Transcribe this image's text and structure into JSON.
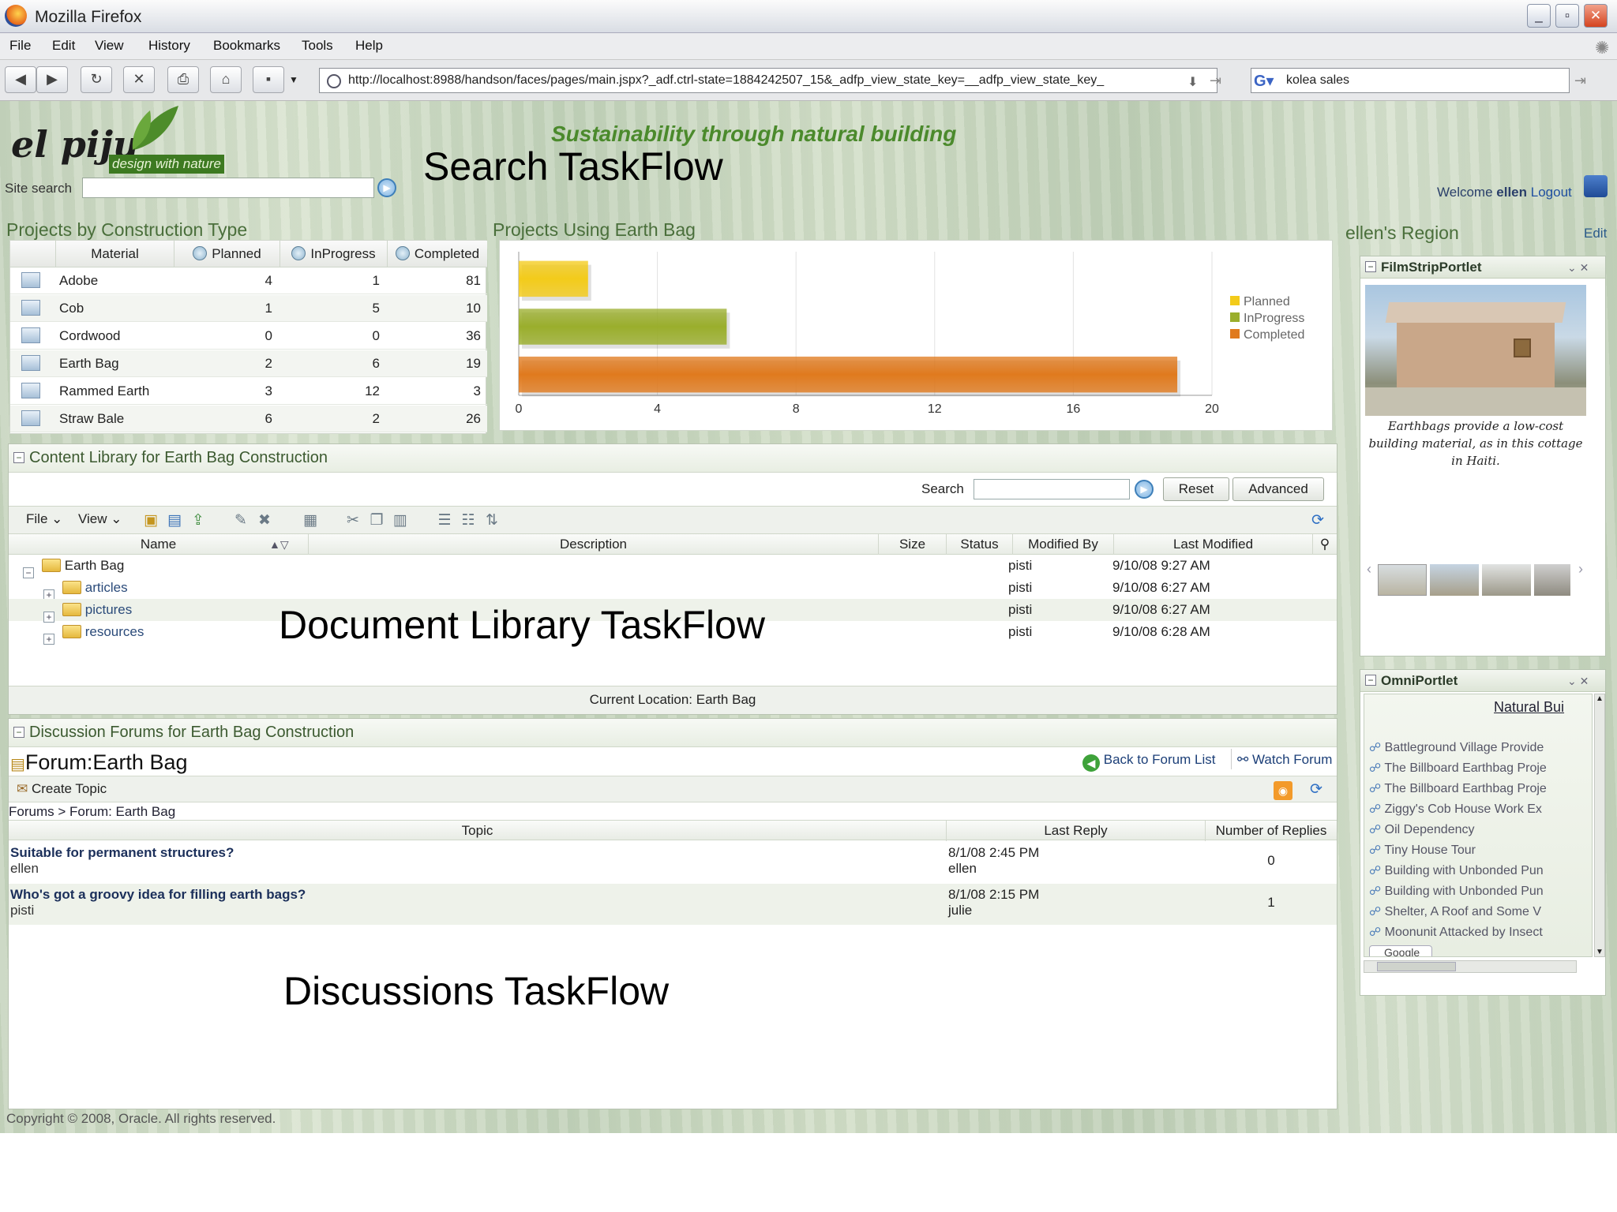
{
  "window": {
    "title": "Mozilla Firefox",
    "minimize": "_",
    "maximize": "▫",
    "close": "✕"
  },
  "menu": [
    "File",
    "Edit",
    "View",
    "History",
    "Bookmarks",
    "Tools",
    "Help"
  ],
  "nav": {
    "url": "http://localhost:8988/handson/faces/pages/main.jspx?_adf.ctrl-state=1884242507_15&_adfp_view_state_key=__adfp_view_state_key_",
    "search_value": "kolea sales"
  },
  "header": {
    "logo_main": "el piju",
    "logo_sub": "design with nature",
    "tagline": "Sustainability through natural building",
    "search_taskflow_caption": "Search TaskFlow",
    "site_search_label": "Site search",
    "welcome": "Welcome",
    "user": "ellen",
    "logout": "Logout"
  },
  "projects_table": {
    "title": "Projects by Construction Type",
    "headers": {
      "material": "Material",
      "planned": "Planned",
      "inprogress": "InProgress",
      "completed": "Completed"
    },
    "rows": [
      {
        "material": "Adobe",
        "planned": "4",
        "inprogress": "1",
        "completed": "81"
      },
      {
        "material": "Cob",
        "planned": "1",
        "inprogress": "5",
        "completed": "10"
      },
      {
        "material": "Cordwood",
        "planned": "0",
        "inprogress": "0",
        "completed": "36"
      },
      {
        "material": "Earth Bag",
        "planned": "2",
        "inprogress": "6",
        "completed": "19"
      },
      {
        "material": "Rammed Earth",
        "planned": "3",
        "inprogress": "12",
        "completed": "3"
      },
      {
        "material": "Straw Bale",
        "planned": "6",
        "inprogress": "2",
        "completed": "26"
      }
    ]
  },
  "chart_title": "Projects Using Earth Bag",
  "chart_data": {
    "type": "bar",
    "orientation": "horizontal",
    "title": "Projects Using Earth Bag",
    "series": [
      {
        "name": "Planned",
        "values": [
          2
        ],
        "color": "#f3cb1a"
      },
      {
        "name": "InProgress",
        "values": [
          6
        ],
        "color": "#9aae2c"
      },
      {
        "name": "Completed",
        "values": [
          19
        ],
        "color": "#e07a1e"
      }
    ],
    "xlim": [
      0,
      20
    ],
    "xticks": [
      "0",
      "4",
      "8",
      "12",
      "16",
      "20"
    ],
    "grid": true,
    "legend": "right"
  },
  "doclib": {
    "title": "Content Library for Earth Bag Construction",
    "search_label": "Search",
    "reset": "Reset",
    "advanced": "Advanced",
    "file_menu": "File",
    "view_menu": "View",
    "columns": {
      "name": "Name",
      "description": "Description",
      "size": "Size",
      "status": "Status",
      "modified_by": "Modified By",
      "last_modified": "Last Modified"
    },
    "rows": [
      {
        "name": "Earth Bag",
        "modified_by": "pisti",
        "last_modified": "9/10/08 9:27 AM",
        "expander": "−"
      },
      {
        "name": "articles",
        "modified_by": "pisti",
        "last_modified": "9/10/08 6:27 AM",
        "expander": "+"
      },
      {
        "name": "pictures",
        "modified_by": "pisti",
        "last_modified": "9/10/08 6:27 AM",
        "expander": "+"
      },
      {
        "name": "resources",
        "modified_by": "pisti",
        "last_modified": "9/10/08 6:28 AM",
        "expander": "+"
      }
    ],
    "caption": "Document Library TaskFlow",
    "current_location": "Current Location: Earth Bag"
  },
  "forum": {
    "title": "Discussion Forums for Earth Bag Construction",
    "name": "Forum:Earth Bag",
    "back": "Back to Forum List",
    "watch": "Watch Forum",
    "create": "Create Topic",
    "breadcrumb": "Forums > Forum: Earth Bag",
    "columns": {
      "topic": "Topic",
      "last_reply": "Last Reply",
      "replies": "Number of Replies"
    },
    "rows": [
      {
        "topic": "Suitable for permanent structures?",
        "author": "ellen",
        "date": "8/1/08 2:45 PM",
        "by": "ellen",
        "replies": "0"
      },
      {
        "topic": "Who's got a groovy idea for filling earth bags?",
        "author": "pisti",
        "date": "8/1/08 2:15 PM",
        "by": "julie",
        "replies": "1"
      }
    ],
    "caption": "Discussions TaskFlow"
  },
  "region": {
    "title": "ellen's Region",
    "edit": "Edit",
    "filmstrip_title": "FilmStripPortlet",
    "filmstrip_caption": "Earthbags provide a low-cost building material, as in this cottage in Haiti.",
    "omni_title": "OmniPortlet",
    "omni_header": "Natural Bui",
    "omni_items": [
      "Battleground Village Provide",
      "The Billboard Earthbag Proje",
      "The Billboard Earthbag Proje",
      "Ziggy's Cob House Work Ex",
      "Oil Dependency",
      "Tiny House Tour",
      "Building with Unbonded Pun",
      "Building with Unbonded Pun",
      "Shelter, A Roof and Some V",
      "Moonunit Attacked by Insect"
    ],
    "omni_footer": "Google"
  },
  "footer": "Copyright © 2008, Oracle. All rights reserved."
}
